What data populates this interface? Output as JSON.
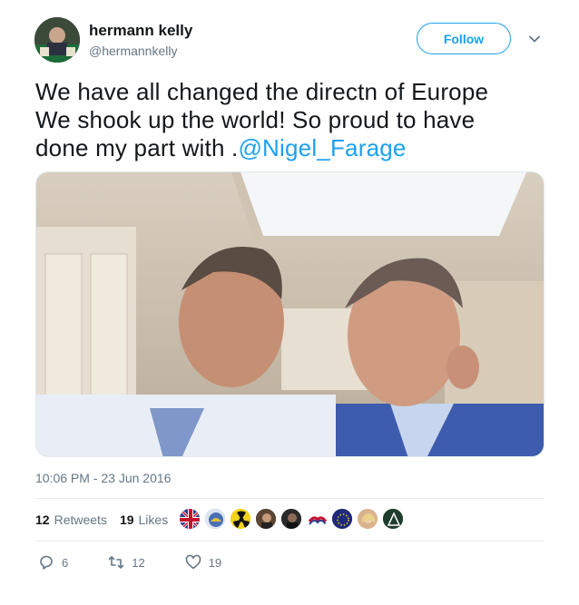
{
  "user": {
    "display_name": "hermann kelly",
    "handle": "@hermannkelly"
  },
  "follow_button": {
    "label": "Follow"
  },
  "tweet": {
    "text_line1": "We have all changed the directn of Europe",
    "text_line2": "We shook up the world! So proud  to have",
    "text_line3_prefix": "done my part with .",
    "mention": "@Nigel_Farage",
    "timestamp": "10:06 PM - 23 Jun 2016"
  },
  "stats": {
    "retweets_count": "12",
    "retweets_label": "Retweets",
    "likes_count": "19",
    "likes_label": "Likes"
  },
  "actions": {
    "reply_count": "6",
    "retweet_count": "12",
    "like_count": "19"
  },
  "icons": {
    "reply": "reply-icon",
    "retweet": "retweet-icon",
    "like": "heart-icon",
    "caret": "chevron-down-icon"
  },
  "colors": {
    "accent": "#1da1f2",
    "secondary_text": "#657786",
    "primary_text": "#14171a"
  }
}
